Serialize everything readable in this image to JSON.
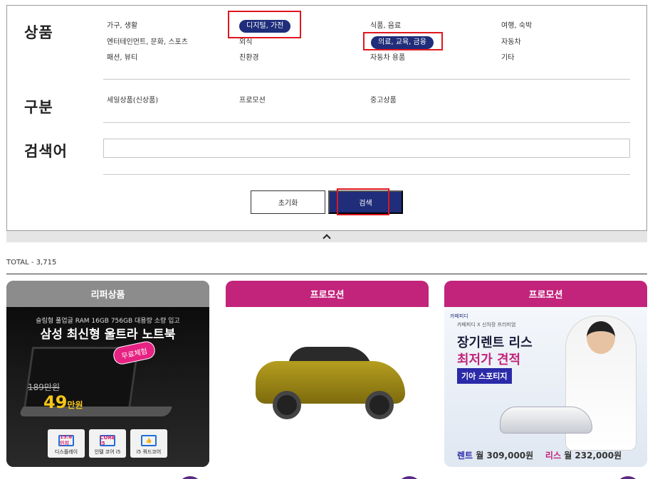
{
  "filter": {
    "product_label": "상품",
    "product_options": [
      [
        "가구, 생활",
        "디지털, 가전",
        "식품, 음료",
        "여행, 숙박"
      ],
      [
        "엔터테인먼트, 문화, 스포츠",
        "외식",
        "의료, 교육, 금융",
        "자동차"
      ],
      [
        "패션, 뷰티",
        "친환경",
        "자동차 용품",
        "기타"
      ]
    ],
    "type_label": "구분",
    "type_options": [
      "세일상품(신상품)",
      "프로모션",
      "중고상품"
    ],
    "keyword_label": "검색어",
    "keyword_value": "",
    "reset_label": "초기화",
    "search_label": "검색"
  },
  "results": {
    "total_text": "TOTAL - 3,715"
  },
  "cards": [
    {
      "header": "리퍼상품",
      "header_color": "#8c8c8c",
      "ad_small": "슬림형 풀업글 RAM 16GB 756GB 대용량 소량 입고",
      "ad_big": "삼성 최신형 울트라 노트북",
      "badge": "무료체험",
      "old_price": "189만원",
      "new_price": "49",
      "price_unit": "만원",
      "features": [
        {
          "icon": "15.6인치",
          "label": "디스플레이"
        },
        {
          "icon": "CORE i5",
          "label": "인텔 코어 i5"
        },
        {
          "icon": "👍",
          "label": "i5 쿼드코어"
        }
      ]
    },
    {
      "header": "프로모션",
      "header_color": "#c2237b"
    },
    {
      "header": "프로모션",
      "header_color": "#c2237b",
      "logo": "카페피디",
      "tagline": "카페피디 X 신차장 프리미엄",
      "headline1": "장기렌트 리스",
      "headline2": "최저가 견적",
      "headline3": "기아 스포티지",
      "rent_label": "렌트",
      "rent_text": "월 309,000원",
      "lease_label": "리스",
      "lease_text": "월 232,000원"
    }
  ],
  "colors": {
    "navy": "#1f2d7a",
    "highlight": "#e0161e",
    "promo": "#c2237b"
  }
}
